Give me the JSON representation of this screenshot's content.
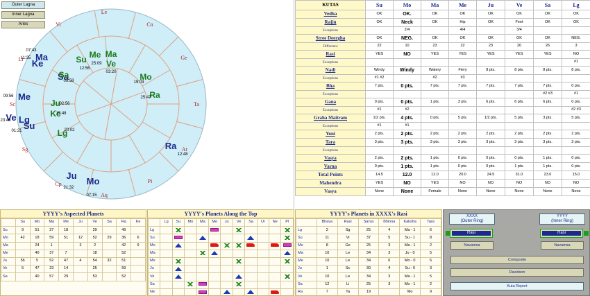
{
  "chart": {
    "buttons": {
      "outer": "Outer Lagna",
      "inner": "Inner Lagna",
      "aries": "Aries"
    },
    "signs": [
      "Le",
      "Cn",
      "Ge",
      "Ta",
      "Ar",
      "Pi",
      "Aq",
      "Cp",
      "Sg",
      "Sc",
      "Li",
      "Vi"
    ],
    "outer_planets": [
      {
        "label": "Ma",
        "color": "#1b2a8c",
        "size": 13
      },
      {
        "label": "Ke",
        "color": "#1b2a8c",
        "size": 13
      },
      {
        "label": "Sa",
        "color": "#1b2a8c",
        "size": 13
      },
      {
        "label": "Me",
        "color": "#1b2a8c",
        "size": 13
      },
      {
        "label": "Ve",
        "color": "#1b2a8c",
        "size": 13
      },
      {
        "label": "Lg",
        "color": "#1b2a8c",
        "size": 13
      },
      {
        "label": "Su",
        "color": "#1b2a8c",
        "size": 13
      },
      {
        "label": "Ju",
        "color": "#1b2a8c",
        "size": 13
      },
      {
        "label": "Mo",
        "color": "#1b2a8c",
        "size": 13
      },
      {
        "label": "Ra",
        "color": "#1b2a8c",
        "size": 13
      }
    ],
    "inner_planets": [
      {
        "label": "Su",
        "color": "#1a7a1a"
      },
      {
        "label": "Me",
        "color": "#1a7a1a"
      },
      {
        "label": "Ma",
        "color": "#1a7a1a"
      },
      {
        "label": "Ve",
        "color": "#1a7a1a"
      },
      {
        "label": "Sa",
        "color": "#1a7a1a"
      },
      {
        "label": "Mo",
        "color": "#1a7a1a"
      },
      {
        "label": "Ra",
        "color": "#1a7a1a"
      },
      {
        "label": "Ju",
        "color": "#1a7a1a"
      },
      {
        "label": "Ke",
        "color": "#1a7a1a"
      },
      {
        "label": "Lg",
        "color": "#1a7a1a"
      }
    ],
    "times": [
      "07:43",
      "11:35",
      "09:58",
      "12:56",
      "25:09",
      "03:20",
      "19:03",
      "25:47",
      "02:56",
      "15:48",
      "20:02",
      "09:56",
      "23:46",
      "01:21",
      "12:48",
      "21:32",
      "07:15"
    ],
    "colors": {
      "outer_fill": "#cfeef8",
      "inner_fill": "#cfeef8",
      "lines": "#e0a080",
      "sign_text": "#b02020"
    }
  },
  "kutas": {
    "header": [
      "KUTAS",
      "Su",
      "Mo",
      "Ma",
      "Me",
      "Ju",
      "Ve",
      "Sa",
      "Lg"
    ],
    "rows": [
      {
        "label": "Vedha",
        "sub": false,
        "cells": [
          "OK",
          "OK.",
          "OK",
          "OK",
          "OK",
          "OK",
          "OK",
          "OK"
        ]
      },
      {
        "label": "Rajju",
        "sub": false,
        "cells": [
          "OK",
          "Neck",
          "OK",
          "Hip",
          "OK",
          "Feet",
          "OK",
          "OK"
        ]
      },
      {
        "label": "Exceptions",
        "sub": true,
        "cells": [
          "",
          "2/4",
          "",
          "4/4",
          "",
          "3/4",
          "",
          ""
        ]
      },
      {
        "label": "Stree Deergha",
        "sub": false,
        "cells": [
          "OK",
          "NEG.",
          "OK",
          "OK",
          "OK",
          "OK",
          "OK",
          "NEG."
        ]
      },
      {
        "label": "Difference",
        "sub": true,
        "cells": [
          "22",
          "10",
          "23",
          "22",
          "23",
          "20",
          "26",
          "3"
        ]
      },
      {
        "label": "Rasi",
        "sub": false,
        "cells": [
          "YES",
          "NO",
          "YES",
          "YES",
          "YES",
          "YES",
          "YES",
          "NO"
        ]
      },
      {
        "label": "Exceptions",
        "sub": true,
        "cells": [
          "",
          "",
          "",
          "",
          "",
          "",
          "",
          "#1"
        ]
      },
      {
        "label": "Nadi",
        "sub": false,
        "cells": [
          "Windy",
          "Windy",
          "Watery",
          "Fiery",
          "8 pts.",
          "8 pts.",
          "8 pts.",
          "8 pts."
        ]
      },
      {
        "label": "Exceptions",
        "sub": true,
        "cells": [
          "#1  #2",
          "",
          "#2",
          "#3",
          "",
          "",
          "",
          ""
        ]
      },
      {
        "label": "Bha",
        "sub": false,
        "cells": [
          "7 pts.",
          "0 pts.",
          "7 pts.",
          "7 pts.",
          "7 pts.",
          "7 pts.",
          "7 pts.",
          "0 pts."
        ]
      },
      {
        "label": "Exceptions",
        "sub": true,
        "cells": [
          "",
          "",
          "",
          "",
          "",
          "",
          "#2  #3",
          "#1"
        ]
      },
      {
        "label": "Gana",
        "sub": false,
        "cells": [
          "0 pts.",
          "0 pts.",
          "1 pts.",
          "3 pts.",
          "6 pts.",
          "6 pts.",
          "6 pts.",
          "0 pts."
        ]
      },
      {
        "label": "Exceptions",
        "sub": true,
        "cells": [
          "#1",
          "#2",
          "",
          "",
          "",
          "",
          "",
          "#2  #3"
        ]
      },
      {
        "label": "Graha Maitram",
        "sub": false,
        "cells": [
          "1/2 pts.",
          "4 pts.",
          "0 pts.",
          "5 pts.",
          "1/2 pts.",
          "5 pts.",
          "3 pts.",
          "5 pts."
        ]
      },
      {
        "label": "Exceptions",
        "sub": true,
        "cells": [
          "#1",
          "#1",
          "",
          "",
          "",
          "",
          "",
          ""
        ]
      },
      {
        "label": "Yoni",
        "sub": false,
        "cells": [
          "2 pts.",
          "2 pts.",
          "2 pts.",
          "2 pts.",
          "2 pts.",
          "2 pts.",
          "2 pts.",
          "2 pts."
        ]
      },
      {
        "label": "Tara",
        "sub": false,
        "cells": [
          "3 pts.",
          "3 pts.",
          "3 pts.",
          "3 pts.",
          "3 pts.",
          "3 pts.",
          "3 pts.",
          "3 pts."
        ]
      },
      {
        "label": "Exceptions",
        "sub": true,
        "cells": [
          "",
          "",
          "",
          "",
          "",
          "",
          "",
          ""
        ]
      },
      {
        "label": "Vasya",
        "sub": false,
        "cells": [
          "2 pts.",
          "2 pts.",
          "1 pts.",
          "0 pts.",
          "0 pts.",
          "0 pts.",
          "1 pts.",
          "0 pts."
        ]
      },
      {
        "label": "Varna",
        "sub": false,
        "cells": [
          "0 pts.",
          "1 pts.",
          "1 pts.",
          "0 pts.",
          "0 pts.",
          "1 pts.",
          "1 pts.",
          "0 pts."
        ]
      },
      {
        "label": "Total Points",
        "sub": false,
        "plain": true,
        "cells": [
          "14.5",
          "12.0",
          "12.0",
          "20.0",
          "24.5",
          "31.0",
          "23.0",
          "15.0"
        ]
      },
      {
        "label": "Mahendra",
        "sub": false,
        "plain": true,
        "cells": [
          "YES",
          "NO",
          "YES",
          "NO",
          "NO",
          "NO",
          "NO",
          "NO"
        ]
      },
      {
        "label": "Vasya",
        "sub": false,
        "plain": true,
        "cells": [
          "None",
          "None",
          "Female",
          "None",
          "None",
          "None",
          "None",
          "None"
        ]
      }
    ]
  },
  "aspected": {
    "title": "YYYY's Aspected Planets",
    "cols": [
      "",
      "Su",
      "Mo",
      "Ma",
      "Me",
      "Ju",
      "Ve",
      "Sa",
      "Ra",
      "Ke"
    ],
    "rows": [
      [
        "Su",
        "9",
        "51",
        "27",
        "18",
        "",
        "29",
        "",
        "49",
        ""
      ],
      [
        "Mo",
        "42",
        "18",
        "59",
        "51",
        "12",
        "52",
        "29",
        "36",
        "6"
      ],
      [
        "Ma",
        "",
        "24",
        "1",
        "",
        "3",
        "2",
        "",
        "42",
        "9"
      ],
      [
        "Me",
        "",
        "40",
        "37",
        "7",
        "",
        "18",
        "",
        "52",
        ""
      ],
      [
        "Ju",
        "56",
        "5",
        "52",
        "47",
        "4",
        "54",
        "32",
        "51",
        ""
      ],
      [
        "Ve",
        "5",
        "47",
        "23",
        "14",
        "",
        "25",
        "",
        "59",
        ""
      ],
      [
        "Sa",
        "",
        "40",
        "57",
        "29",
        "",
        "53",
        "",
        "52",
        ""
      ]
    ]
  },
  "along_top": {
    "title": "YYYY's Planets Along the Top",
    "cols": [
      "",
      "Lg",
      "Su",
      "Mo",
      "Ma",
      "Me",
      "Ju",
      "Ve",
      "Sa",
      "Ur",
      "Ne",
      "Pl"
    ],
    "rows": [
      {
        "label": "Lg",
        "cells": [
          "",
          "grn",
          "",
          "",
          "mag",
          "",
          "grn",
          "",
          "",
          "",
          "grn"
        ]
      },
      {
        "label": "Su",
        "cells": [
          "",
          "mag",
          "",
          "tri",
          "",
          "",
          "",
          "tri",
          "",
          "",
          "grn"
        ]
      },
      {
        "label": "Mo",
        "cells": [
          "",
          "tri",
          "",
          "",
          "red",
          "grn",
          "grn",
          "red",
          "",
          "red",
          "mag"
        ]
      },
      {
        "label": "Ma",
        "cells": [
          "",
          "",
          "",
          "grn",
          "tri",
          "",
          "",
          "",
          "",
          "",
          "tri"
        ]
      },
      {
        "label": "Me",
        "cells": [
          "",
          "grn",
          "",
          "",
          "",
          "",
          "grn",
          "",
          "",
          "",
          "grn"
        ]
      },
      {
        "label": "Ju",
        "cells": [
          "",
          "tri",
          "",
          "",
          "",
          "",
          "",
          "",
          "",
          "",
          ""
        ]
      },
      {
        "label": "Ve",
        "cells": [
          "",
          "tri",
          "",
          "",
          "",
          "",
          "tri",
          "",
          "",
          "",
          "grn"
        ]
      },
      {
        "label": "Sa",
        "cells": [
          "",
          "",
          "grn",
          "mag",
          "",
          "",
          "grn",
          "",
          "",
          "",
          ""
        ]
      },
      {
        "label": "Ne",
        "cells": [
          "",
          "",
          "",
          "mag",
          "",
          "tri",
          "",
          "tri",
          "",
          "red",
          ""
        ]
      },
      {
        "label": "Pl",
        "cells": [
          "",
          "",
          "",
          "grn",
          "",
          "",
          "grn",
          "",
          "",
          "",
          ""
        ]
      }
    ]
  },
  "rasi": {
    "title": "YYYY's Planets in XXXX's Rasi",
    "cols": [
      "",
      "Bhava",
      "Rasi",
      "Sarva",
      "Bhinna",
      "Kaksha",
      "Tara"
    ],
    "rows": [
      [
        "Lg",
        "2",
        "Sg",
        "25",
        "4",
        "Ma - 1",
        "6"
      ],
      [
        "Su",
        "11",
        "Vi",
        "37",
        "5",
        "Su - 1",
        "8"
      ],
      [
        "Mo",
        "8",
        "Ge",
        "25",
        "3",
        "Ma - 1",
        "2"
      ],
      [
        "Ma",
        "10",
        "Le",
        "34",
        "3",
        "Ju - 0",
        "5"
      ],
      [
        "Me",
        "10",
        "Le",
        "34",
        "6",
        "Mo - 0",
        "6"
      ],
      [
        "Ju",
        "1",
        "Sc",
        "30",
        "4",
        "Su - 0",
        "3"
      ],
      [
        "Ve",
        "10",
        "Le",
        "34",
        "3",
        "Ma - 1",
        "5"
      ],
      [
        "Sa",
        "12",
        "Li",
        "25",
        "3",
        "Mo - 1",
        "2"
      ],
      [
        "Ra",
        "7",
        "Ta",
        "19",
        "",
        "Mo",
        "9"
      ],
      [
        "Ke",
        "1",
        "Sc",
        "30",
        "",
        "Mo",
        "9"
      ]
    ]
  },
  "controls": {
    "left_label": "XXXX\n(Outer Ring)",
    "right_label": "YYYY\n(Inner Ring)",
    "rasi": "Rasi",
    "navamsa": "Navamsa",
    "composite": "Composite",
    "davidson": "Davidson",
    "kuta_report": "Kuta Report"
  }
}
